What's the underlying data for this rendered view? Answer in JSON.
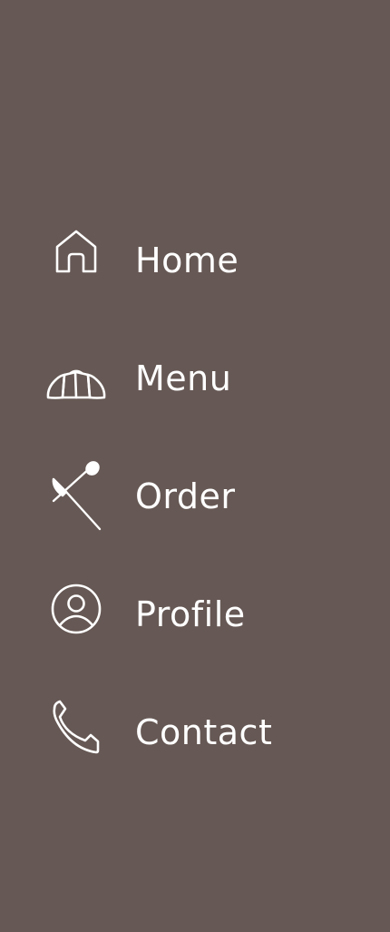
{
  "theme": {
    "background": "#665854",
    "foreground": "#ffffff"
  },
  "nav": {
    "items": [
      {
        "label": "Home",
        "icon": "home-icon"
      },
      {
        "label": "Menu",
        "icon": "croissant-icon"
      },
      {
        "label": "Order",
        "icon": "utensils-icon"
      },
      {
        "label": "Profile",
        "icon": "user-circle-icon"
      },
      {
        "label": "Contact",
        "icon": "phone-icon"
      }
    ]
  }
}
